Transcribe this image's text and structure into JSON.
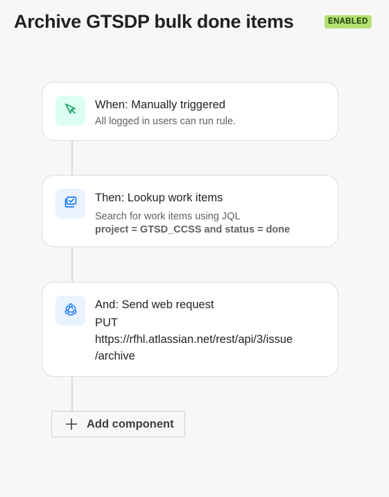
{
  "header": {
    "title": "Archive GTSDP bulk done items",
    "status_badge": "ENABLED"
  },
  "colors": {
    "badge_bg": "#b3df72",
    "trigger_icon_bg": "#dcfff1",
    "trigger_icon": "#22a06b",
    "action_icon_bg": "#e9f2ff",
    "action_icon": "#1d7afc"
  },
  "components": [
    {
      "icon": "cursor-pointer-icon",
      "title": "When: Manually triggered",
      "description": "All logged in users can run rule."
    },
    {
      "icon": "lookup-icon",
      "title": "Then: Lookup work items",
      "description": "Search for work items using JQL",
      "query": "project = GTSD_CCSS and status = done"
    },
    {
      "icon": "webhook-icon",
      "title": "And: Send web request",
      "method": "PUT",
      "url_line1": "https://rfhl.atlassian.net/rest/api/3/issue",
      "url_line2": "/archive"
    }
  ],
  "add_component": {
    "label": "Add component",
    "icon": "plus-icon"
  }
}
